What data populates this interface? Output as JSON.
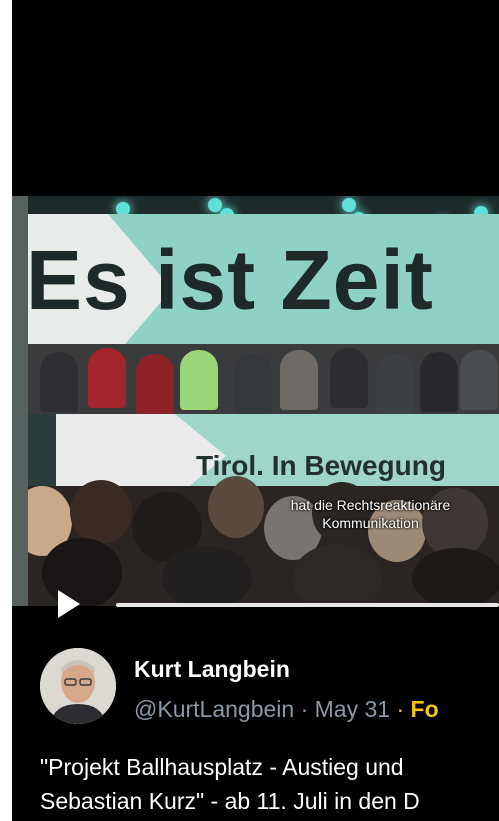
{
  "video": {
    "banner_text": "Es ist Zeit",
    "lower_banner_text": "Tirol. In Bewegung",
    "caption_line1": "hat die Rechtsreaktionäre",
    "caption_line2": "Kommunikation"
  },
  "tweet": {
    "display_name": "Kurt Langbein",
    "handle": "@KurtLangbein",
    "separator": "·",
    "date": "May 31",
    "follow_label": "Fo",
    "text_line1": "\"Projekt Ballhausplatz - Austieg und",
    "text_line2": "Sebastian Kurz\" - ab 11. Juli in den D"
  },
  "colors": {
    "background": "#000000",
    "secondary_text": "#8b98a5",
    "follow_accent": "#f2c41b",
    "banner_green": "#8fd1c4"
  }
}
